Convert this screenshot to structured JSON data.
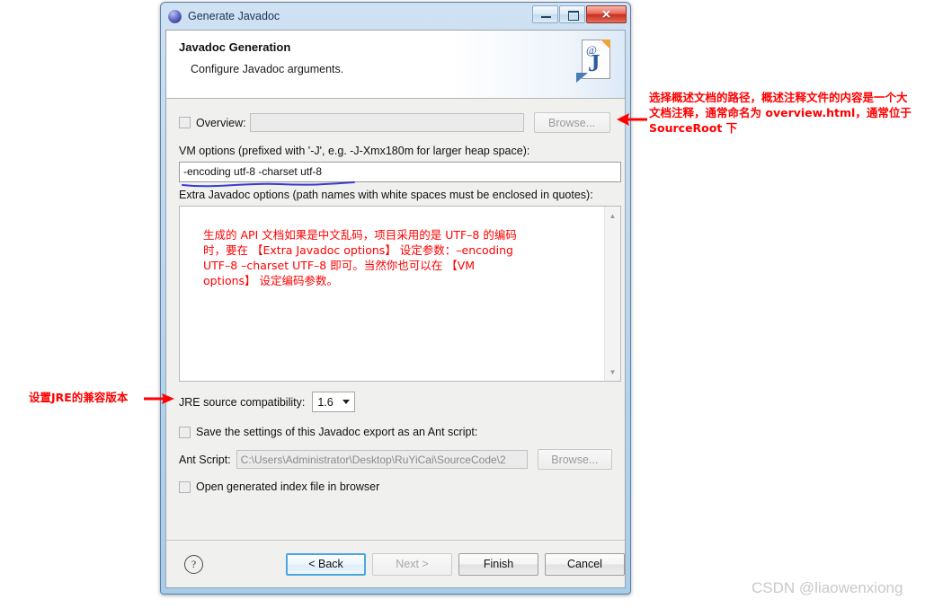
{
  "window": {
    "title": "Generate Javadoc",
    "title_icon": "globe-icon",
    "buttons": {
      "minimize": "minimize-icon",
      "maximize": "maximize-icon",
      "close": "✕"
    }
  },
  "header": {
    "title": "Javadoc Generation",
    "subtitle": "Configure Javadoc arguments.",
    "icon": "javadoc-page-icon",
    "icon_glyph_at": "@",
    "icon_glyph_j": "J"
  },
  "form": {
    "overview": {
      "label": "Overview:",
      "checked": false,
      "value": "",
      "placeholder": "",
      "browse_label": "Browse..."
    },
    "vm_options": {
      "label": "VM options (prefixed with '-J', e.g. -J-Xmx180m for larger heap space):",
      "value": "-encoding utf-8 -charset utf-8"
    },
    "extra_options": {
      "label": "Extra Javadoc options (path names with white spaces must be enclosed in quotes):",
      "value": "生成的 API 文档如果是中文乱码，项目采用的是 UTF–8 的编码\n时，要在 【Extra Javadoc options】 设定参数：–encoding\nUTF–8 –charset UTF–8 即可。当然你也可以在 【VM\noptions】 设定编码参数。",
      "scrollbar_up": "▲",
      "scrollbar_down": "▼"
    },
    "jre_compatibility": {
      "label": "JRE source compatibility:",
      "value": "1.6",
      "caret": "chevron-down-icon"
    },
    "save_ant": {
      "label": "Save the settings of this Javadoc export as an Ant script:",
      "checked": false
    },
    "ant_script": {
      "label": "Ant Script:",
      "value": "C:\\Users\\Administrator\\Desktop\\RuYiCai\\SourceCode\\2",
      "browse_label": "Browse..."
    },
    "open_index": {
      "label": "Open generated index file in browser",
      "checked": false
    }
  },
  "footer": {
    "help": "?",
    "back": "< Back",
    "next": "Next >",
    "finish": "Finish",
    "cancel": "Cancel"
  },
  "annotations": {
    "right": "选择概述文档的路径，概述注释文件的内容是一个大\n文档注释，通常命名为 overview.html，通常位于\nSourceRoot 下",
    "left": "设置JRE的兼容版本"
  },
  "watermark": "CSDN @liaowenxiong",
  "colors": {
    "annotation_red": "#ff0000",
    "underline_blue": "#3b3bd0",
    "title_blue": "#18335b",
    "close_red": "#c92c1c"
  }
}
